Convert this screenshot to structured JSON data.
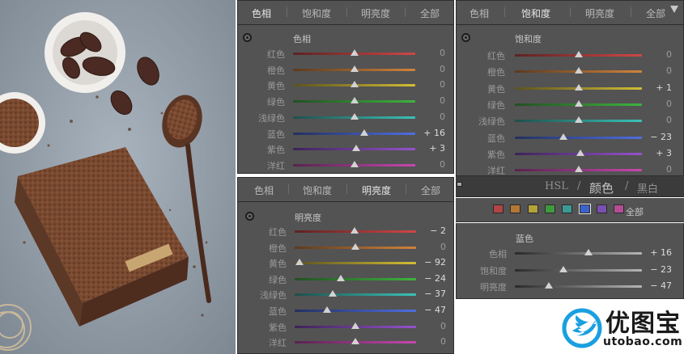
{
  "colors": {
    "panel_bg": "#535353",
    "slider_thumb": "#d2d2d2",
    "logo_blue": "#1a9fe0"
  },
  "tracks": {
    "red": "linear-gradient(to right,#5c2323,#d04646)",
    "orange": "linear-gradient(to right,#5c3a1f,#d0843c)",
    "yellow": "linear-gradient(to right,#5c5220,#d2bd35)",
    "green": "linear-gradient(to right,#244f24,#3db43d)",
    "aqua": "linear-gradient(to right,#1f4f4c,#3ac2b8)",
    "blue": "linear-gradient(to right,#23305f,#4f6ee0)",
    "purple": "linear-gradient(to right,#3d2358,#9552cc)",
    "magenta": "linear-gradient(to right,#58234e,#c847b0)",
    "gray": "linear-gradient(to right,#2a2a2a,#b5b5b5)"
  },
  "hue_panel": {
    "tabs": [
      "色相",
      "饱和度",
      "明亮度",
      "全部"
    ],
    "active_tab": 0,
    "title": "色相",
    "rows": [
      {
        "label": "红色",
        "value": "0",
        "pos": 0.5
      },
      {
        "label": "橙色",
        "value": "0",
        "pos": 0.5
      },
      {
        "label": "黄色",
        "value": "0",
        "pos": 0.5
      },
      {
        "label": "绿色",
        "value": "0",
        "pos": 0.5
      },
      {
        "label": "浅绿色",
        "value": "0",
        "pos": 0.5
      },
      {
        "label": "蓝色",
        "value": "+ 16",
        "pos": 0.58
      },
      {
        "label": "紫色",
        "value": "+ 3",
        "pos": 0.515
      },
      {
        "label": "洋红",
        "value": "0",
        "pos": 0.5
      }
    ]
  },
  "luminance_panel": {
    "tabs": [
      "色相",
      "饱和度",
      "明亮度",
      "全部"
    ],
    "active_tab": 2,
    "title": "明亮度",
    "rows": [
      {
        "label": "红色",
        "value": "− 2",
        "pos": 0.49
      },
      {
        "label": "橙色",
        "value": "0",
        "pos": 0.5
      },
      {
        "label": "黄色",
        "value": "− 92",
        "pos": 0.04
      },
      {
        "label": "绿色",
        "value": "− 24",
        "pos": 0.38
      },
      {
        "label": "浅绿色",
        "value": "− 37",
        "pos": 0.315
      },
      {
        "label": "蓝色",
        "value": "− 47",
        "pos": 0.265
      },
      {
        "label": "紫色",
        "value": "0",
        "pos": 0.5
      },
      {
        "label": "洋红",
        "value": "0",
        "pos": 0.5
      }
    ]
  },
  "saturation_panel": {
    "tabs": [
      "色相",
      "饱和度",
      "明亮度",
      "全部"
    ],
    "active_tab": 1,
    "title": "饱和度",
    "rows": [
      {
        "label": "红色",
        "value": "0",
        "pos": 0.5
      },
      {
        "label": "橙色",
        "value": "0",
        "pos": 0.5
      },
      {
        "label": "黄色",
        "value": "+ 1",
        "pos": 0.505
      },
      {
        "label": "绿色",
        "value": "0",
        "pos": 0.5
      },
      {
        "label": "浅绿色",
        "value": "0",
        "pos": 0.5
      },
      {
        "label": "蓝色",
        "value": "− 23",
        "pos": 0.385
      },
      {
        "label": "紫色",
        "value": "+ 3",
        "pos": 0.515
      },
      {
        "label": "洋红",
        "value": "0",
        "pos": 0.5
      }
    ]
  },
  "hsl_header": {
    "hsl": "HSL",
    "color": "颜色",
    "bw": "黑白",
    "slash": "/"
  },
  "color_panel": {
    "chips": [
      "#b24545",
      "#b37838",
      "#b3a338",
      "#3f9a3f",
      "#3c9a95",
      "#3c63cc",
      "#7c4fb3",
      "#b34e95"
    ],
    "selected_chip": 5,
    "all_label": "全部",
    "title": "蓝色",
    "rows": [
      {
        "label": "色相",
        "value": "+ 16",
        "pos": 0.58
      },
      {
        "label": "饱和度",
        "value": "− 23",
        "pos": 0.385
      },
      {
        "label": "明亮度",
        "value": "− 47",
        "pos": 0.265
      }
    ]
  },
  "logo": {
    "name": "优图宝",
    "url": "utobao.com"
  }
}
